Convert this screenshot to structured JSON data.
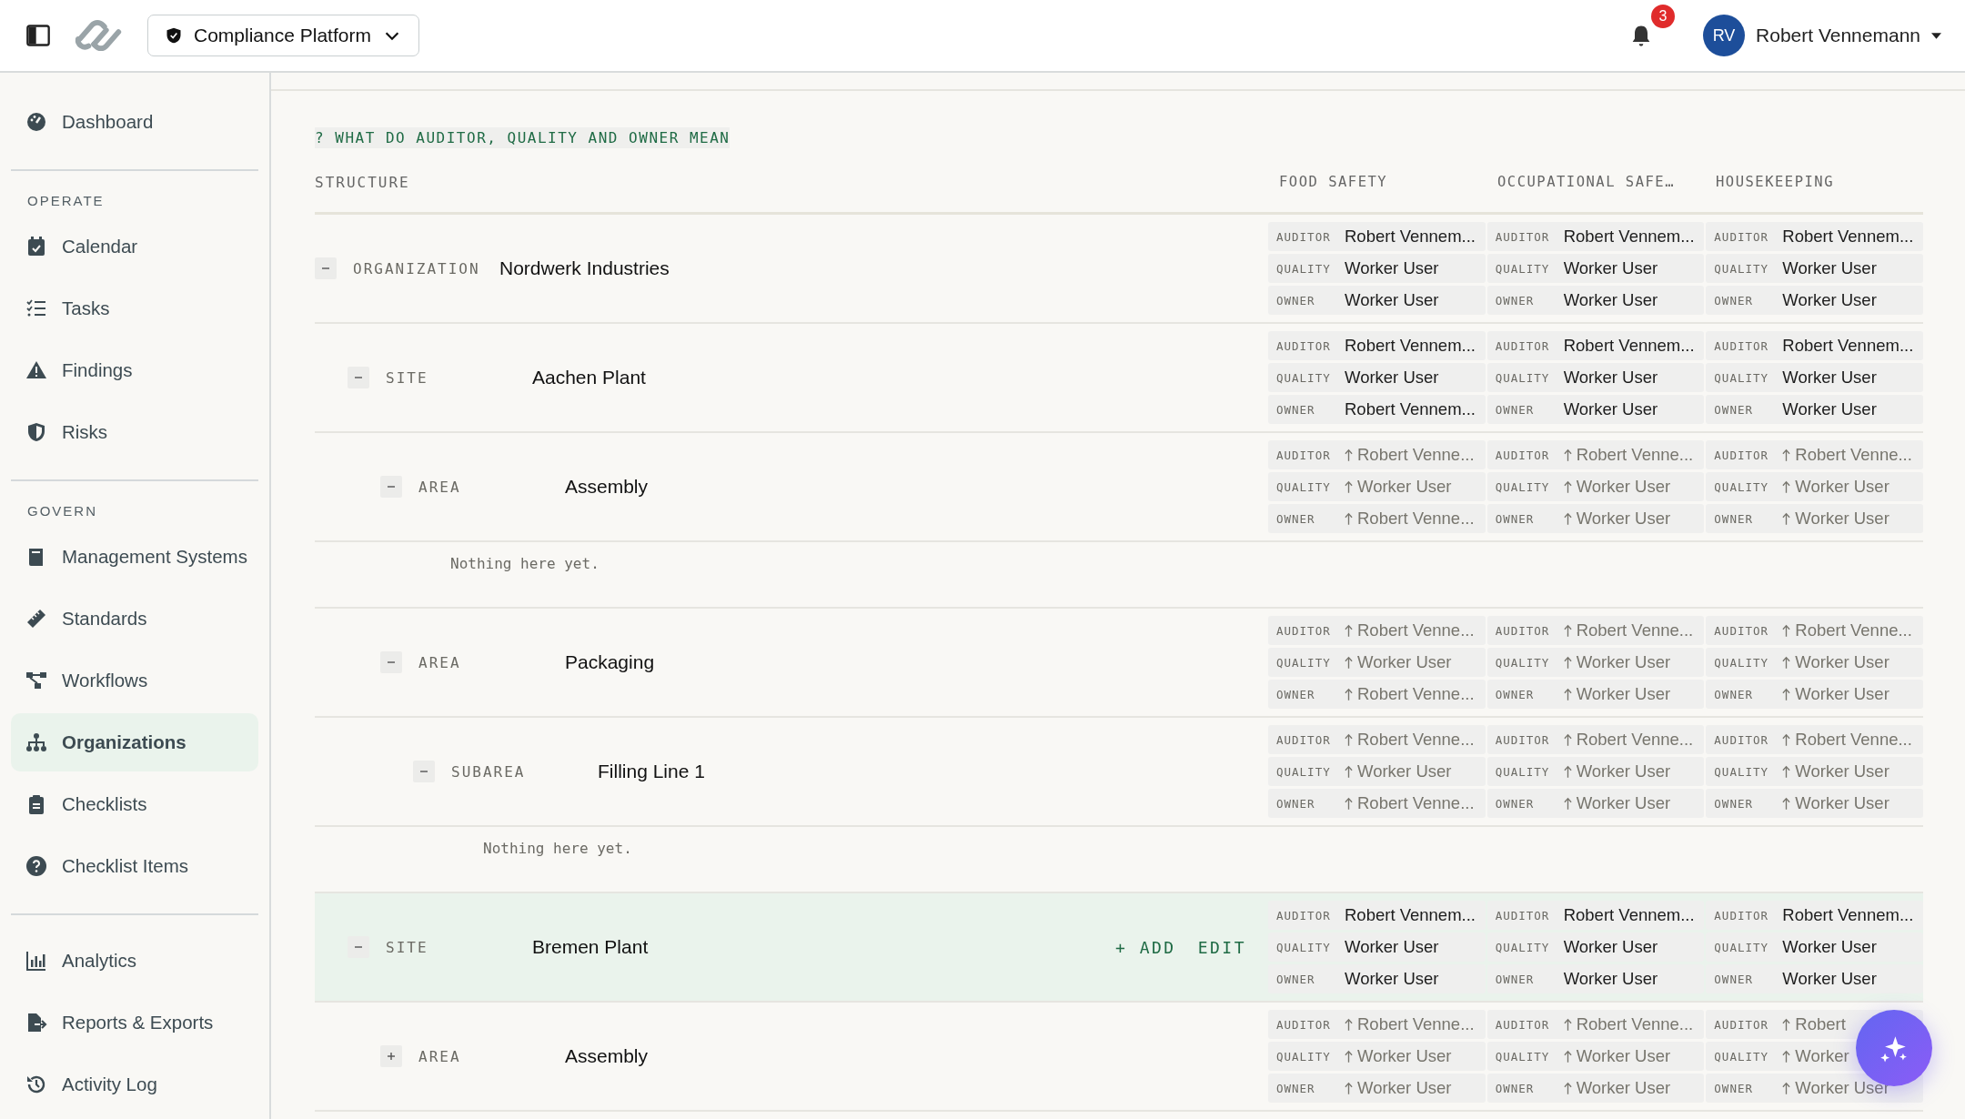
{
  "topbar": {
    "workspace": "Compliance Platform",
    "notifications": "3",
    "user_initials": "RV",
    "user_name": "Robert Vennemann"
  },
  "sidebar": {
    "groups": [
      {
        "items": [
          {
            "label": "Dashboard",
            "selected": false
          }
        ]
      },
      {
        "title": "OPERATE",
        "items": [
          {
            "label": "Calendar",
            "selected": false
          },
          {
            "label": "Tasks",
            "selected": false
          },
          {
            "label": "Findings",
            "selected": false
          },
          {
            "label": "Risks",
            "selected": false
          }
        ]
      },
      {
        "title": "GOVERN",
        "items": [
          {
            "label": "Management Systems",
            "selected": false
          },
          {
            "label": "Standards",
            "selected": false
          },
          {
            "label": "Workflows",
            "selected": false
          },
          {
            "label": "Organizations",
            "selected": true
          },
          {
            "label": "Checklists",
            "selected": false
          },
          {
            "label": "Checklist Items",
            "selected": false
          }
        ]
      },
      {
        "items": [
          {
            "label": "Analytics",
            "selected": false
          },
          {
            "label": "Reports & Exports",
            "selected": false
          },
          {
            "label": "Activity Log",
            "selected": false
          }
        ]
      }
    ]
  },
  "help_link": "? WHAT DO AUDITOR, QUALITY AND OWNER MEAN",
  "table": {
    "structure_heading": "STRUCTURE",
    "columns": [
      "FOOD SAFETY",
      "OCCUPATIONAL SAFE…",
      "HOUSEKEEPING"
    ],
    "tree": [
      {
        "type": "ORGANIZATION",
        "name": "Nordwerk Industries",
        "expanded": true,
        "selected": false,
        "assignments": [
          [
            {
              "role": "AUDITOR",
              "name": "Robert Vennem...",
              "inherited": false
            },
            {
              "role": "QUALITY",
              "name": "Worker User",
              "inherited": false
            },
            {
              "role": "OWNER",
              "name": "Worker User",
              "inherited": false
            }
          ],
          [
            {
              "role": "AUDITOR",
              "name": "Robert Vennem...",
              "inherited": false
            },
            {
              "role": "QUALITY",
              "name": "Worker User",
              "inherited": false
            },
            {
              "role": "OWNER",
              "name": "Worker User",
              "inherited": false
            }
          ],
          [
            {
              "role": "AUDITOR",
              "name": "Robert Vennem...",
              "inherited": false
            },
            {
              "role": "QUALITY",
              "name": "Worker User",
              "inherited": false
            },
            {
              "role": "OWNER",
              "name": "Worker User",
              "inherited": false
            }
          ]
        ],
        "children": [
          {
            "type": "SITE",
            "name": "Aachen Plant",
            "expanded": true,
            "selected": false,
            "assignments": [
              [
                {
                  "role": "AUDITOR",
                  "name": "Robert Vennem...",
                  "inherited": false
                },
                {
                  "role": "QUALITY",
                  "name": "Worker User",
                  "inherited": false
                },
                {
                  "role": "OWNER",
                  "name": "Robert Vennem...",
                  "inherited": false
                }
              ],
              [
                {
                  "role": "AUDITOR",
                  "name": "Robert Vennem...",
                  "inherited": false
                },
                {
                  "role": "QUALITY",
                  "name": "Worker User",
                  "inherited": false
                },
                {
                  "role": "OWNER",
                  "name": "Worker User",
                  "inherited": false
                }
              ],
              [
                {
                  "role": "AUDITOR",
                  "name": "Robert Vennem...",
                  "inherited": false
                },
                {
                  "role": "QUALITY",
                  "name": "Worker User",
                  "inherited": false
                },
                {
                  "role": "OWNER",
                  "name": "Worker User",
                  "inherited": false
                }
              ]
            ],
            "children": [
              {
                "type": "AREA",
                "name": "Assembly",
                "expanded": true,
                "selected": false,
                "empty_text": "Nothing here yet.",
                "assignments": [
                  [
                    {
                      "role": "AUDITOR",
                      "name": "Robert Venne...",
                      "inherited": true
                    },
                    {
                      "role": "QUALITY",
                      "name": "Worker User",
                      "inherited": true
                    },
                    {
                      "role": "OWNER",
                      "name": "Robert Venne...",
                      "inherited": true
                    }
                  ],
                  [
                    {
                      "role": "AUDITOR",
                      "name": "Robert Venne...",
                      "inherited": true
                    },
                    {
                      "role": "QUALITY",
                      "name": "Worker User",
                      "inherited": true
                    },
                    {
                      "role": "OWNER",
                      "name": "Worker User",
                      "inherited": true
                    }
                  ],
                  [
                    {
                      "role": "AUDITOR",
                      "name": "Robert Venne...",
                      "inherited": true
                    },
                    {
                      "role": "QUALITY",
                      "name": "Worker User",
                      "inherited": true
                    },
                    {
                      "role": "OWNER",
                      "name": "Worker User",
                      "inherited": true
                    }
                  ]
                ]
              },
              {
                "type": "AREA",
                "name": "Packaging",
                "expanded": true,
                "selected": false,
                "assignments": [
                  [
                    {
                      "role": "AUDITOR",
                      "name": "Robert Venne...",
                      "inherited": true
                    },
                    {
                      "role": "QUALITY",
                      "name": "Worker User",
                      "inherited": true
                    },
                    {
                      "role": "OWNER",
                      "name": "Robert Venne...",
                      "inherited": true
                    }
                  ],
                  [
                    {
                      "role": "AUDITOR",
                      "name": "Robert Venne...",
                      "inherited": true
                    },
                    {
                      "role": "QUALITY",
                      "name": "Worker User",
                      "inherited": true
                    },
                    {
                      "role": "OWNER",
                      "name": "Worker User",
                      "inherited": true
                    }
                  ],
                  [
                    {
                      "role": "AUDITOR",
                      "name": "Robert Venne...",
                      "inherited": true
                    },
                    {
                      "role": "QUALITY",
                      "name": "Worker User",
                      "inherited": true
                    },
                    {
                      "role": "OWNER",
                      "name": "Worker User",
                      "inherited": true
                    }
                  ]
                ],
                "children": [
                  {
                    "type": "SUBAREA",
                    "name": "Filling Line 1",
                    "expanded": true,
                    "selected": false,
                    "empty_text": "Nothing here yet.",
                    "assignments": [
                      [
                        {
                          "role": "AUDITOR",
                          "name": "Robert Venne...",
                          "inherited": true
                        },
                        {
                          "role": "QUALITY",
                          "name": "Worker User",
                          "inherited": true
                        },
                        {
                          "role": "OWNER",
                          "name": "Robert Venne...",
                          "inherited": true
                        }
                      ],
                      [
                        {
                          "role": "AUDITOR",
                          "name": "Robert Venne...",
                          "inherited": true
                        },
                        {
                          "role": "QUALITY",
                          "name": "Worker User",
                          "inherited": true
                        },
                        {
                          "role": "OWNER",
                          "name": "Worker User",
                          "inherited": true
                        }
                      ],
                      [
                        {
                          "role": "AUDITOR",
                          "name": "Robert Venne...",
                          "inherited": true
                        },
                        {
                          "role": "QUALITY",
                          "name": "Worker User",
                          "inherited": true
                        },
                        {
                          "role": "OWNER",
                          "name": "Worker User",
                          "inherited": true
                        }
                      ]
                    ]
                  }
                ]
              }
            ]
          },
          {
            "type": "SITE",
            "name": "Bremen Plant",
            "expanded": true,
            "selected": true,
            "actions": [
              "+ ADD",
              "EDIT"
            ],
            "assignments": [
              [
                {
                  "role": "AUDITOR",
                  "name": "Robert Vennem...",
                  "inherited": false
                },
                {
                  "role": "QUALITY",
                  "name": "Worker User",
                  "inherited": false
                },
                {
                  "role": "OWNER",
                  "name": "Worker User",
                  "inherited": false
                }
              ],
              [
                {
                  "role": "AUDITOR",
                  "name": "Robert Vennem...",
                  "inherited": false
                },
                {
                  "role": "QUALITY",
                  "name": "Worker User",
                  "inherited": false
                },
                {
                  "role": "OWNER",
                  "name": "Worker User",
                  "inherited": false
                }
              ],
              [
                {
                  "role": "AUDITOR",
                  "name": "Robert Vennem...",
                  "inherited": false
                },
                {
                  "role": "QUALITY",
                  "name": "Worker User",
                  "inherited": false
                },
                {
                  "role": "OWNER",
                  "name": "Worker User",
                  "inherited": false
                }
              ]
            ],
            "children": [
              {
                "type": "AREA",
                "name": "Assembly",
                "expanded": false,
                "selected": false,
                "assignments": [
                  [
                    {
                      "role": "AUDITOR",
                      "name": "Robert Venne...",
                      "inherited": true
                    },
                    {
                      "role": "QUALITY",
                      "name": "Worker User",
                      "inherited": true
                    },
                    {
                      "role": "OWNER",
                      "name": "Worker User",
                      "inherited": true
                    }
                  ],
                  [
                    {
                      "role": "AUDITOR",
                      "name": "Robert Venne...",
                      "inherited": true
                    },
                    {
                      "role": "QUALITY",
                      "name": "Worker User",
                      "inherited": true
                    },
                    {
                      "role": "OWNER",
                      "name": "Worker User",
                      "inherited": true
                    }
                  ],
                  [
                    {
                      "role": "AUDITOR",
                      "name": "Robert",
                      "inherited": true
                    },
                    {
                      "role": "QUALITY",
                      "name": "Worker",
                      "inherited": true
                    },
                    {
                      "role": "OWNER",
                      "name": "Worker User",
                      "inherited": true
                    }
                  ]
                ]
              }
            ]
          }
        ]
      }
    ]
  }
}
